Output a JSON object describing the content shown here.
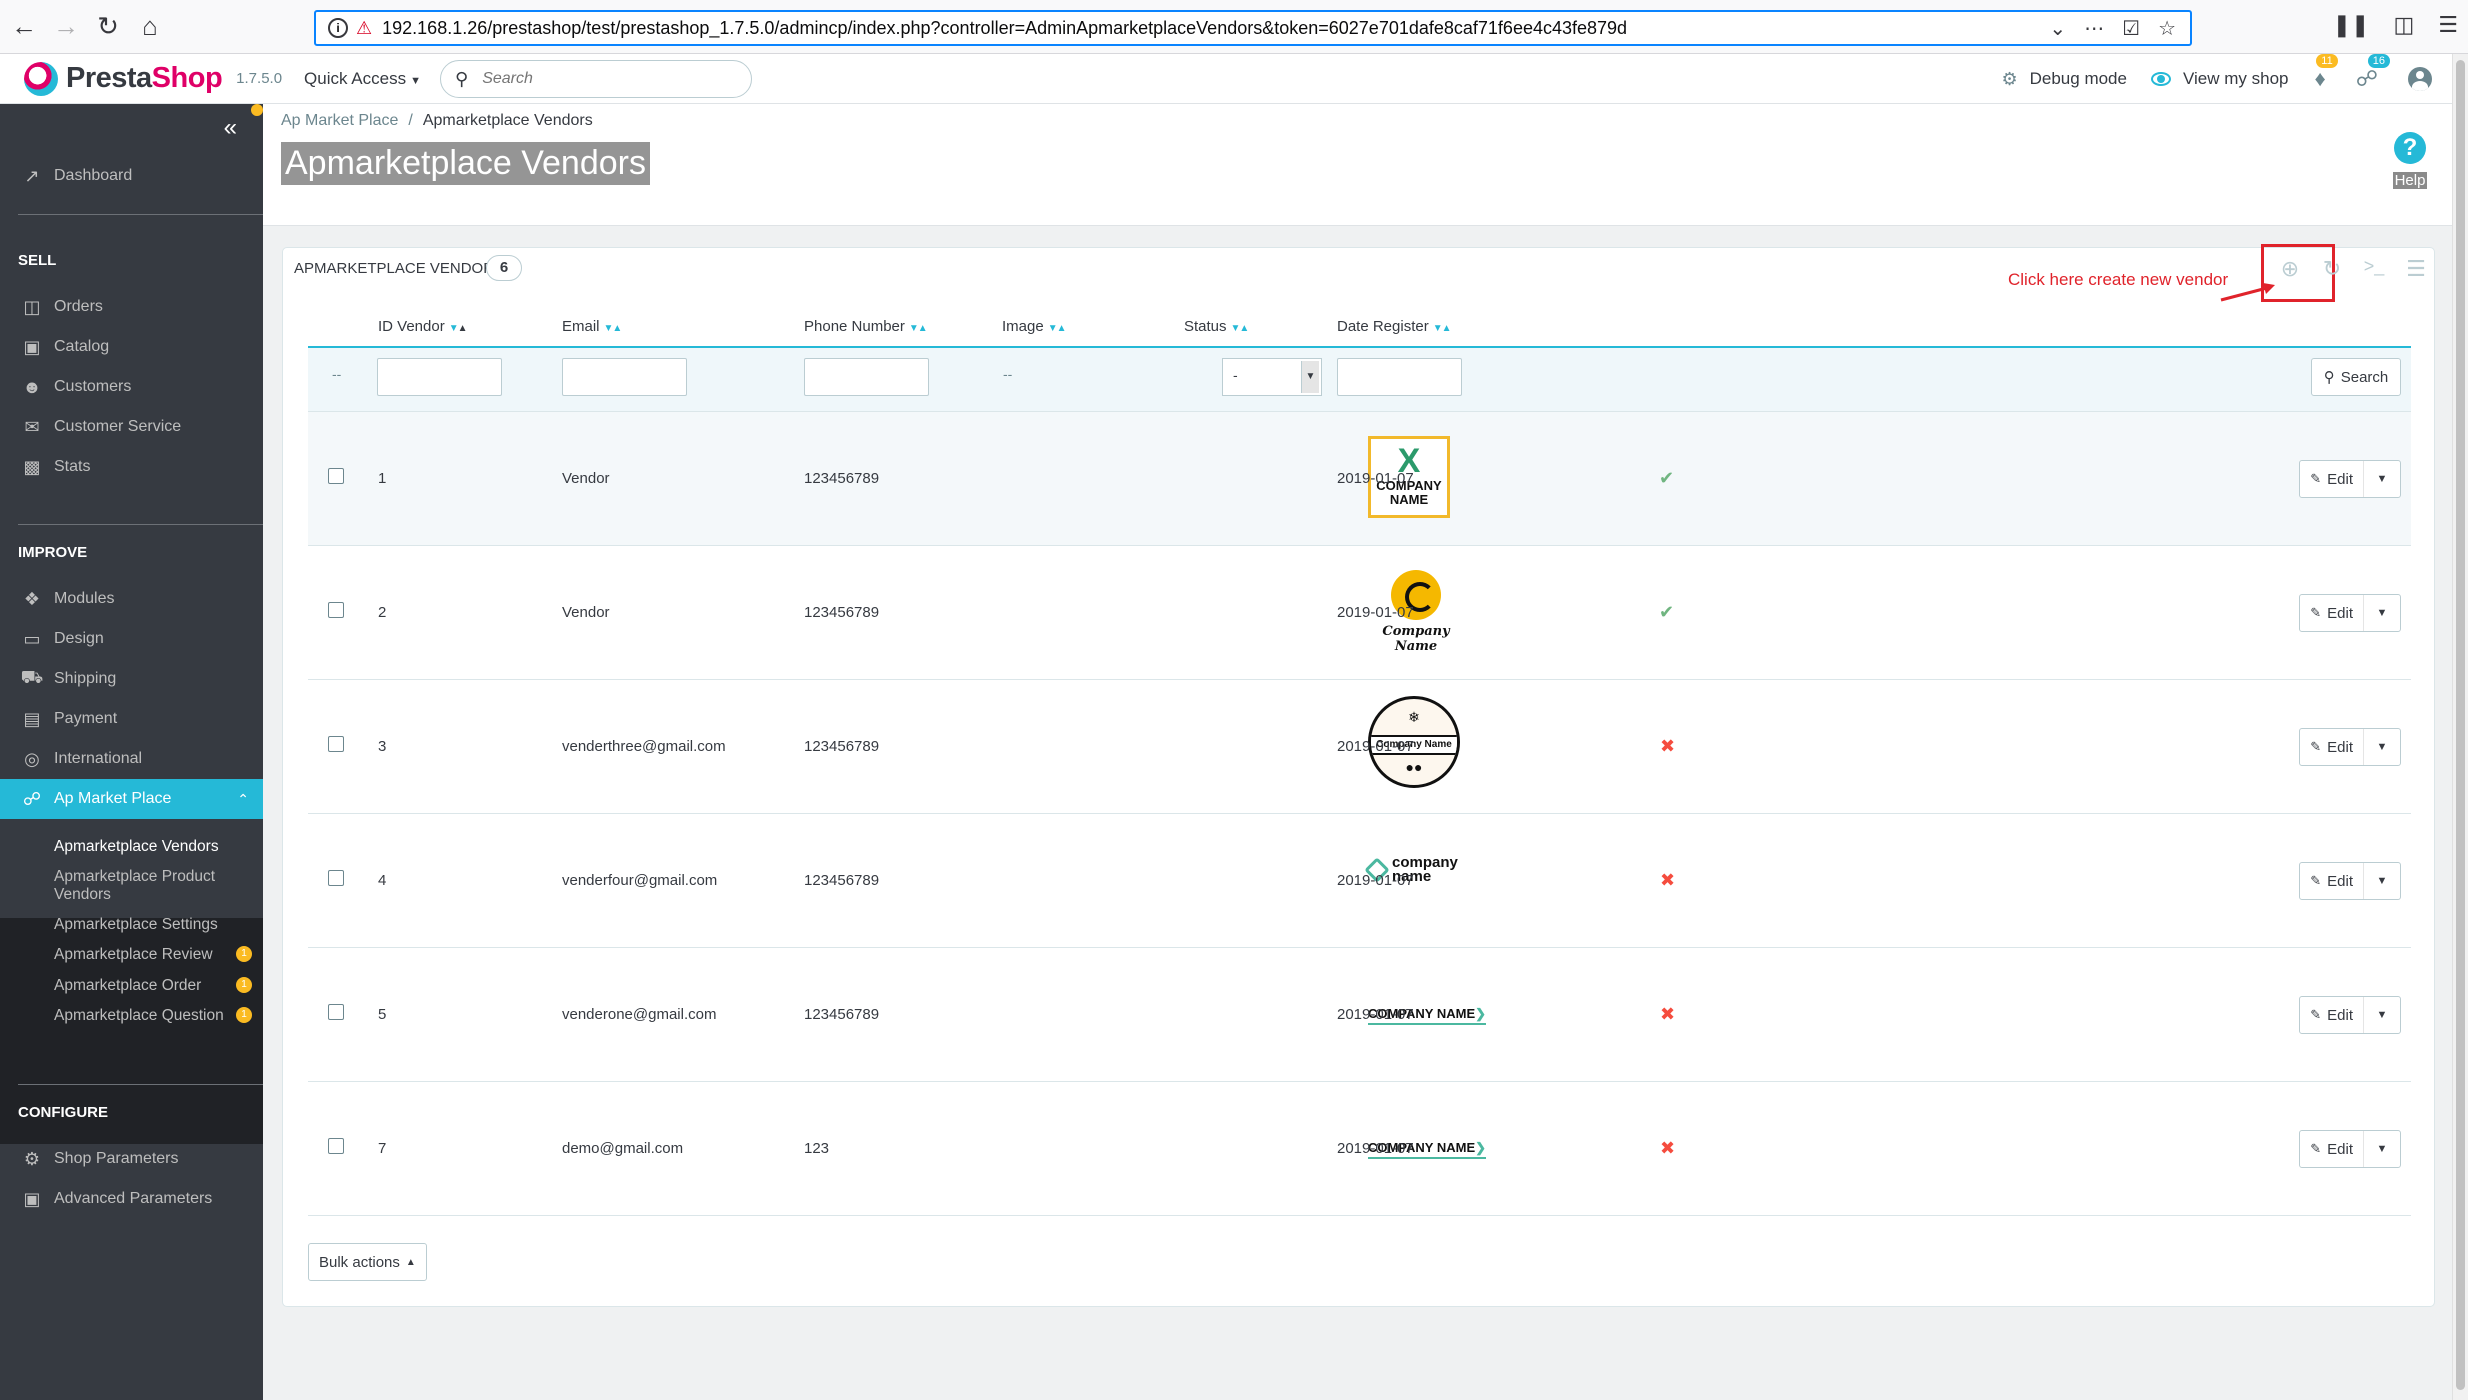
{
  "browser": {
    "url": "192.168.1.26/prestashop/test/prestashop_1.7.5.0/admincp/index.php?controller=AdminApmarketplaceVendors&token=6027e701dafe8caf71f6ee4c43fe879d"
  },
  "header": {
    "logo_prefix": "Presta",
    "logo_suffix": "Shop",
    "version": "1.7.5.0",
    "quick_access": "Quick Access",
    "search_placeholder": "Search",
    "debug_mode": "Debug mode",
    "view_shop": "View my shop",
    "notifications_count": "11",
    "orders_count": "16"
  },
  "sidebar": {
    "top_items": [
      {
        "label": "Dashboard",
        "icon": "trending-up-icon"
      }
    ],
    "sections": [
      {
        "title": "SELL",
        "items": [
          {
            "label": "Orders",
            "icon": "inbox-icon"
          },
          {
            "label": "Catalog",
            "icon": "store-icon"
          },
          {
            "label": "Customers",
            "icon": "account-circle-icon"
          },
          {
            "label": "Customer Service",
            "icon": "chat-icon"
          },
          {
            "label": "Stats",
            "icon": "bar-chart-icon"
          }
        ]
      },
      {
        "title": "IMPROVE",
        "items": [
          {
            "label": "Modules",
            "icon": "puzzle-icon"
          },
          {
            "label": "Design",
            "icon": "desktop-icon"
          },
          {
            "label": "Shipping",
            "icon": "truck-icon"
          },
          {
            "label": "Payment",
            "icon": "credit-card-icon"
          },
          {
            "label": "International",
            "icon": "globe-icon"
          },
          {
            "label": "Ap Market Place",
            "icon": "cart-icon"
          }
        ]
      },
      {
        "title": "CONFIGURE",
        "items": [
          {
            "label": "Shop Parameters",
            "icon": "settings-icon"
          },
          {
            "label": "Advanced Parameters",
            "icon": "settings-applications-icon"
          }
        ]
      }
    ],
    "submenu": [
      {
        "label": "Apmarketplace Vendors"
      },
      {
        "label": "Apmarketplace Product Vendors"
      },
      {
        "label": "Apmarketplace Settings"
      },
      {
        "label": "Apmarketplace Review",
        "badge": "1"
      },
      {
        "label": "Apmarketplace Order",
        "badge": "1"
      },
      {
        "label": "Apmarketplace Question",
        "badge": "1"
      }
    ]
  },
  "page": {
    "breadcrumb_parent": "Ap Market Place",
    "breadcrumb_current": "Apmarketplace Vendors",
    "title": "Apmarketplace Vendors",
    "help": "Help"
  },
  "panel": {
    "title": "Apmarketplace Vendors",
    "count": "6",
    "annotation": "Click here create new vendor",
    "columns": [
      "ID Vendor",
      "Email",
      "Phone Number",
      "Image",
      "Status",
      "Date Register"
    ],
    "filter_dash": "--",
    "image_dash": "--",
    "status_filter": "-",
    "search_button": "Search",
    "edit_label": "Edit",
    "bulk_actions": "Bulk actions",
    "rows": [
      {
        "id": "1",
        "email": "Vendor",
        "phone": "123456789",
        "status": true,
        "date": "2019-01-07",
        "logo_text_1": "X",
        "logo_text_2": "COMPANY",
        "logo_text_3": "NAME"
      },
      {
        "id": "2",
        "email": "Vendor",
        "phone": "123456789",
        "status": true,
        "date": "2019-01-07",
        "logo_text": "Company Name"
      },
      {
        "id": "3",
        "email": "venderthree@gmail.com",
        "phone": "123456789",
        "status": false,
        "date": "2019-01-07",
        "logo_text": "Company Name"
      },
      {
        "id": "4",
        "email": "venderfour@gmail.com",
        "phone": "123456789",
        "status": false,
        "date": "2019-01-07",
        "logo_text_1": "company",
        "logo_text_2": "name"
      },
      {
        "id": "5",
        "email": "venderone@gmail.com",
        "phone": "123456789",
        "status": false,
        "date": "2019-01-07",
        "logo_text": "COMPANY NAME"
      },
      {
        "id": "7",
        "email": "demo@gmail.com",
        "phone": "123",
        "status": false,
        "date": "2019-01-07",
        "logo_text": "COMPANY NAME"
      }
    ]
  }
}
